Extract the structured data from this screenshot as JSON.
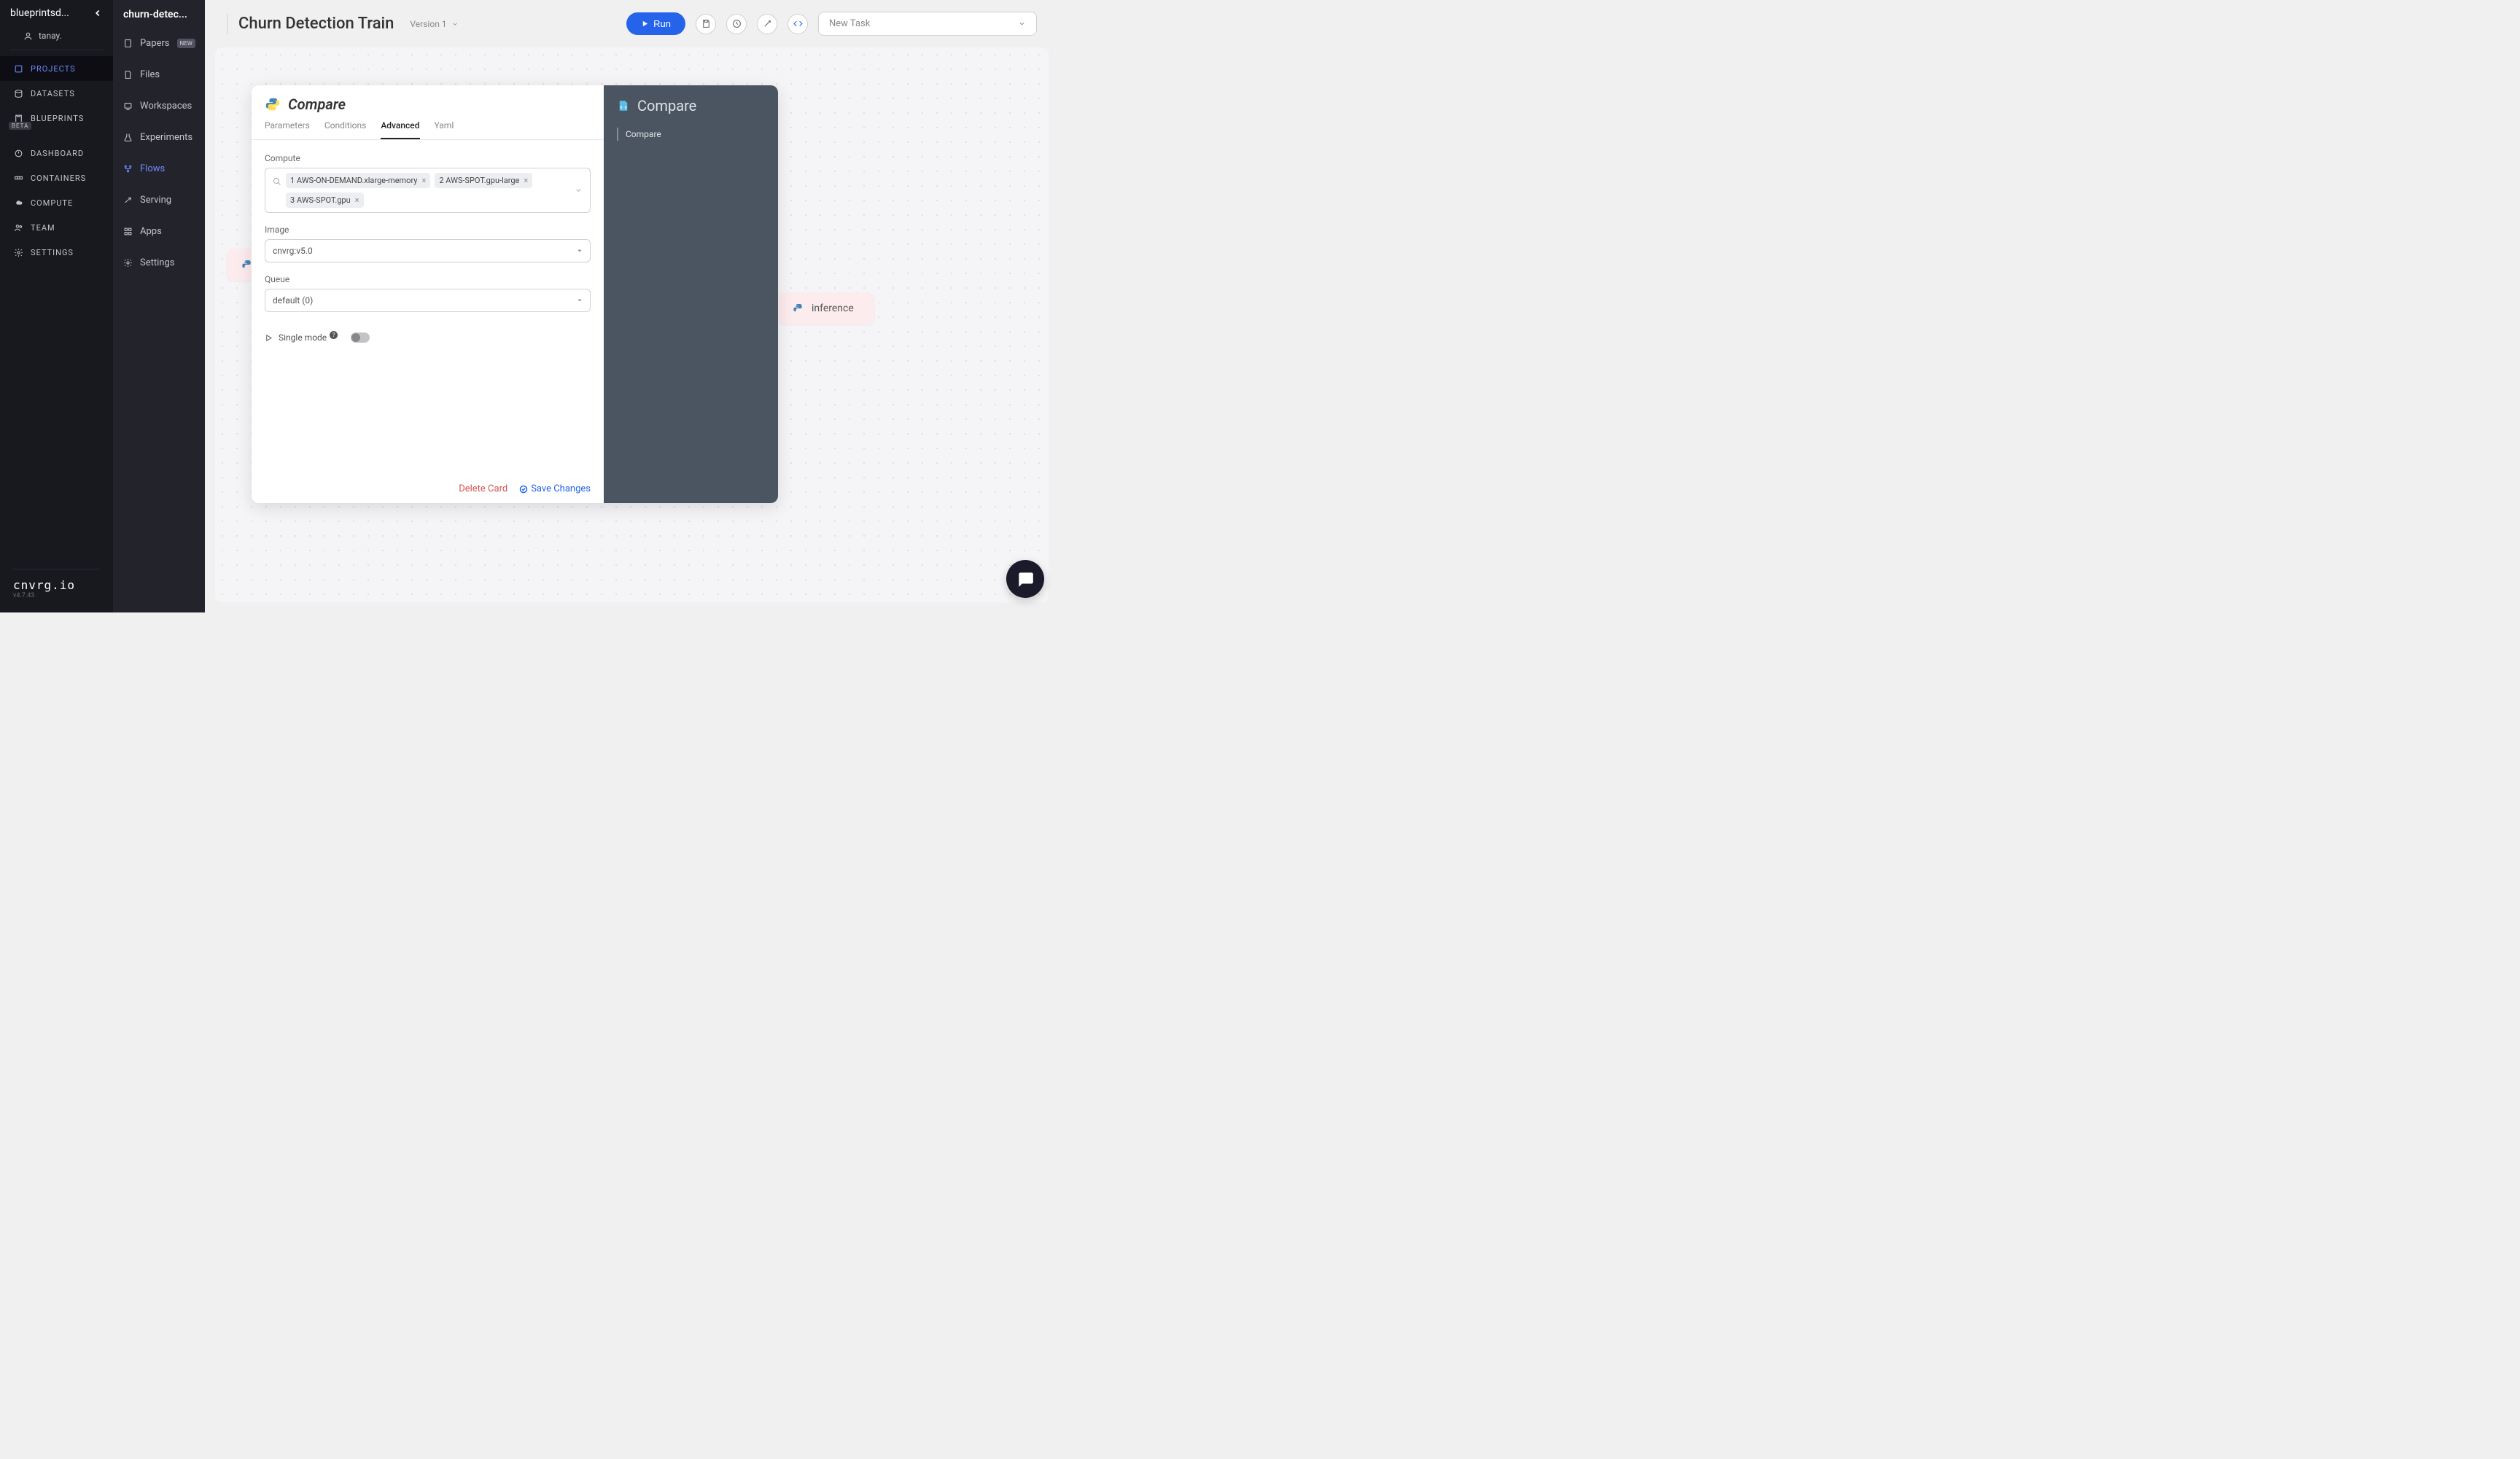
{
  "sidebar": {
    "org": "blueprintsd...",
    "user": "tanay.",
    "nav": [
      {
        "id": "projects",
        "label": "PROJECTS",
        "active": true
      },
      {
        "id": "datasets",
        "label": "DATASETS"
      },
      {
        "id": "blueprints",
        "label": "BLUEPRINTS",
        "beta": "BETA"
      },
      {
        "id": "dashboard",
        "label": "DASHBOARD"
      },
      {
        "id": "containers",
        "label": "CONTAINERS"
      },
      {
        "id": "compute",
        "label": "COMPUTE"
      },
      {
        "id": "team",
        "label": "TEAM"
      },
      {
        "id": "settings",
        "label": "SETTINGS"
      }
    ],
    "brand": "cnvrg.io",
    "brand_ver": "v4.7.43"
  },
  "subnav": {
    "title": "churn-detec...",
    "items": [
      {
        "id": "papers",
        "label": "Papers",
        "badge": "NEW"
      },
      {
        "id": "files",
        "label": "Files"
      },
      {
        "id": "workspaces",
        "label": "Workspaces"
      },
      {
        "id": "experiments",
        "label": "Experiments"
      },
      {
        "id": "flows",
        "label": "Flows",
        "active": true
      },
      {
        "id": "serving",
        "label": "Serving"
      },
      {
        "id": "apps",
        "label": "Apps"
      },
      {
        "id": "settings",
        "label": "Settings"
      }
    ]
  },
  "header": {
    "title": "Churn Detection Train",
    "version": "Version 1",
    "run_label": "Run",
    "new_task": "New Task"
  },
  "nodes": {
    "inference": "inference"
  },
  "modal": {
    "title": "Compare",
    "tabs": [
      "Parameters",
      "Conditions",
      "Advanced",
      "Yaml"
    ],
    "active_tab": "Advanced",
    "compute_label": "Compute",
    "compute_chips": [
      "1 AWS-ON-DEMAND.xlarge-memory",
      "2 AWS-SPOT.gpu-large",
      "3 AWS-SPOT.gpu"
    ],
    "image_label": "Image",
    "image_value": "cnvrg:v5.0",
    "queue_label": "Queue",
    "queue_value": "default (0)",
    "single_mode_label": "Single mode",
    "delete_label": "Delete Card",
    "save_label": "Save Changes",
    "right_title": "Compare",
    "right_sub": "Compare"
  }
}
